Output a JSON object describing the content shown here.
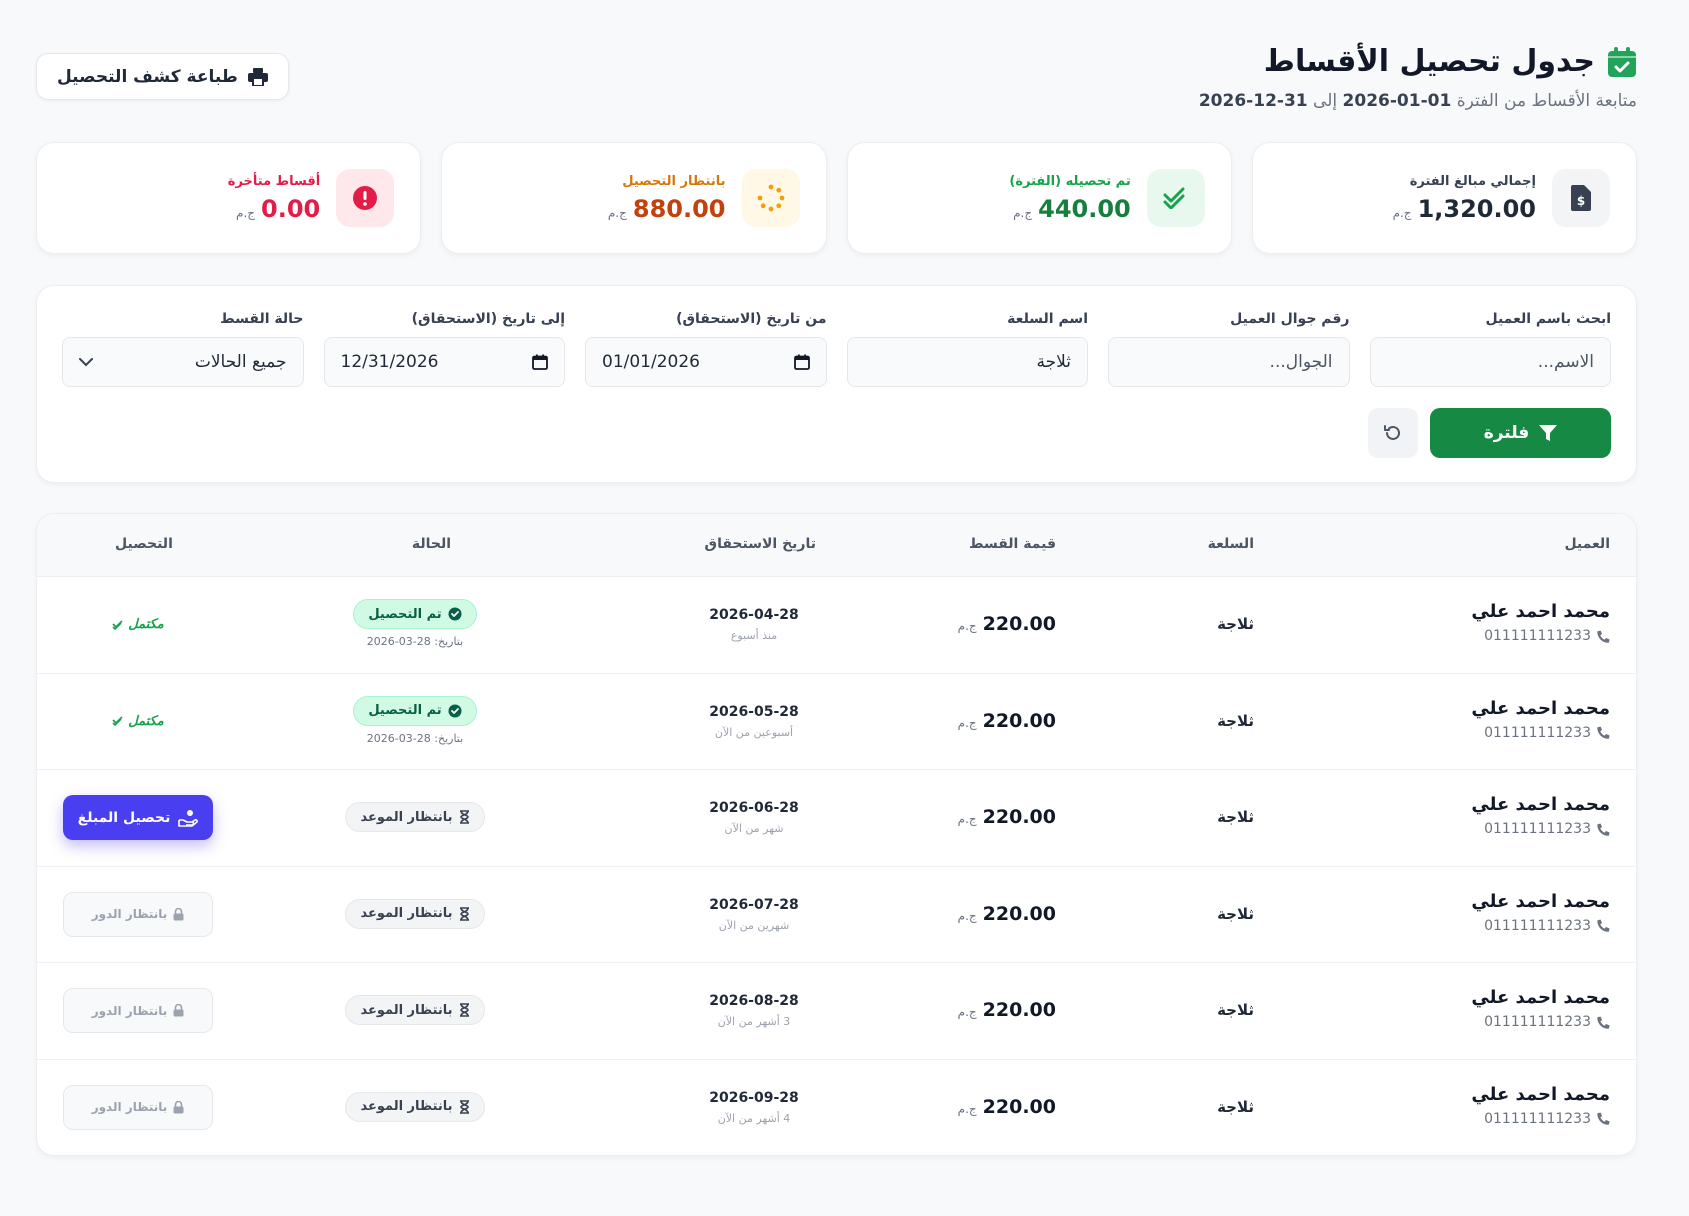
{
  "header": {
    "title": "جدول تحصيل الأقساط",
    "subtitle_prefix": "متابعة الأقساط من الفترة",
    "date_from": "01-01-2026",
    "subtitle_to": "إلى",
    "date_to": "31-12-2026",
    "print_label": "طباعة كشف التحصيل"
  },
  "stats": [
    {
      "label": "إجمالي مبالغ الفترة",
      "value": "1,320.00",
      "currency": "ج.م",
      "color": "#1f2937",
      "icon": "invoice-dollar-icon"
    },
    {
      "label": "تم تحصيله (الفترة)",
      "value": "440.00",
      "currency": "ج.م",
      "color": "#15803d",
      "icon": "double-check-icon"
    },
    {
      "label": "بانتظار التحصيل",
      "value": "880.00",
      "currency": "ج.م",
      "color": "#c2410c",
      "icon": "spinner-icon"
    },
    {
      "label": "أقساط متأخرة",
      "value": "0.00",
      "currency": "ج.م",
      "color": "#e11d48",
      "icon": "alert-circle-icon"
    }
  ],
  "filters": {
    "client_name": {
      "label": "ابحث باسم العميل",
      "placeholder": "الاسم..."
    },
    "client_phone": {
      "label": "رقم جوال العميل",
      "placeholder": "الجوال..."
    },
    "item_name": {
      "label": "اسم السلعة",
      "value": "ثلاجة"
    },
    "from_date": {
      "label": "من تاريخ (الاستحقاق)",
      "value": "01/01/2026"
    },
    "to_date": {
      "label": "إلى تاريخ (الاستحقاق)",
      "value": "12/31/2026"
    },
    "status": {
      "label": "حالة القسط",
      "value": "جميع الحالات"
    },
    "filter_button": "فلترة"
  },
  "table": {
    "columns": {
      "client": "العميل",
      "item": "السلعة",
      "amount": "قيمة القسط",
      "due": "تاريخ الاستحقاق",
      "status": "الحالة",
      "collection": "التحصيل"
    },
    "rows": [
      {
        "name": "محمد احمد علي",
        "phone": "011111111233",
        "item": "ثلاجة",
        "amount": "220.00",
        "currency": "ج.م",
        "due": "2026-04-28",
        "relative": "منذ أسبوع",
        "status": "تم التحصيل",
        "paid_on": "بتاريخ: 28-03-2026",
        "action": "مكتمل"
      },
      {
        "name": "محمد احمد علي",
        "phone": "011111111233",
        "item": "ثلاجة",
        "amount": "220.00",
        "currency": "ج.م",
        "due": "2026-05-28",
        "relative": "أسبوعين من الآن",
        "status": "تم التحصيل",
        "paid_on": "بتاريخ: 28-03-2026",
        "action": "مكتمل"
      },
      {
        "name": "محمد احمد علي",
        "phone": "011111111233",
        "item": "ثلاجة",
        "amount": "220.00",
        "currency": "ج.م",
        "due": "2026-06-28",
        "relative": "شهر من الآن",
        "status": "بانتظار الموعد",
        "action": "تحصيل المبلغ"
      },
      {
        "name": "محمد احمد علي",
        "phone": "011111111233",
        "item": "ثلاجة",
        "amount": "220.00",
        "currency": "ج.م",
        "due": "2026-07-28",
        "relative": "شهرين من الآن",
        "status": "بانتظار الموعد",
        "action": "بانتظار الدور"
      },
      {
        "name": "محمد احمد علي",
        "phone": "011111111233",
        "item": "ثلاجة",
        "amount": "220.00",
        "currency": "ج.م",
        "due": "2026-08-28",
        "relative": "3 أشهر من الآن",
        "status": "بانتظار الموعد",
        "action": "بانتظار الدور"
      },
      {
        "name": "محمد احمد علي",
        "phone": "011111111233",
        "item": "ثلاجة",
        "amount": "220.00",
        "currency": "ج.م",
        "due": "2026-09-28",
        "relative": "4 أشهر من الآن",
        "status": "بانتظار الموعد",
        "action": "بانتظار الدور"
      }
    ]
  }
}
